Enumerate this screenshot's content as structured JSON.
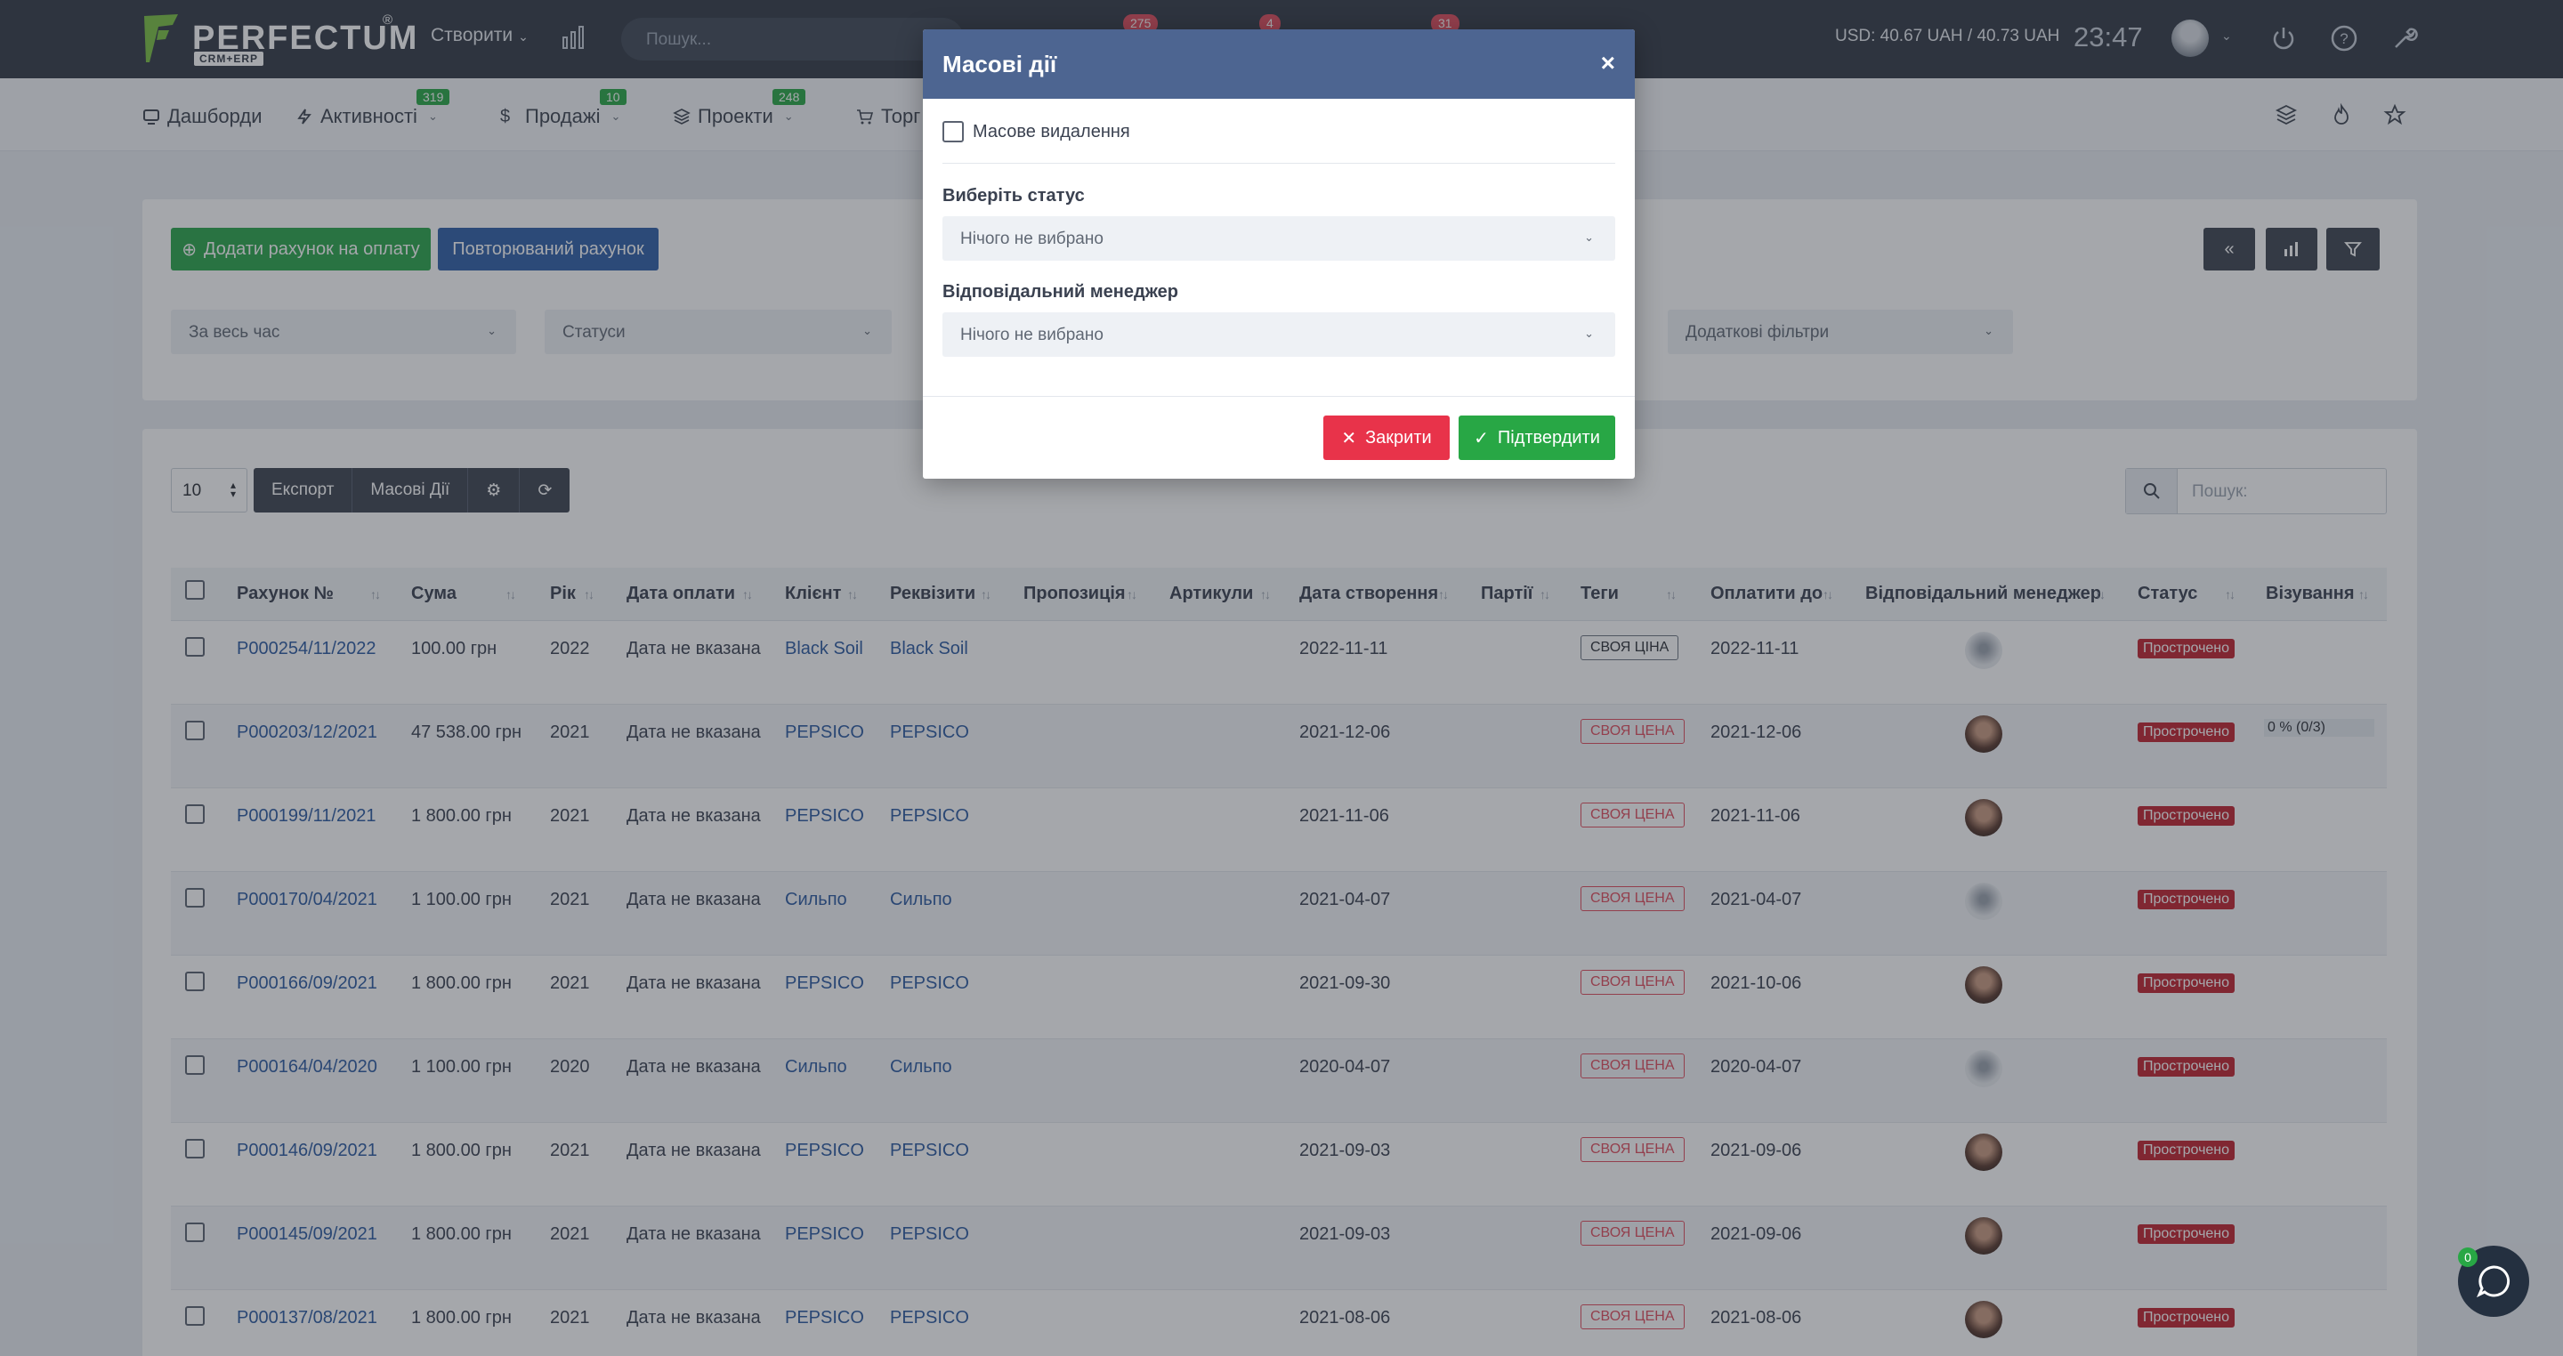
{
  "topbar": {
    "logo_text": "PERFECTUM",
    "logo_reg": "®",
    "logo_sub": "CRM+ERP",
    "create_label": "Створити",
    "search_placeholder": "Пошук...",
    "badges": [
      "275",
      "4",
      "31"
    ],
    "usd_rate": "USD: 40.67 UAH / 40.73 UAH",
    "clock": "23:47",
    "icons": [
      "power-icon",
      "help-icon",
      "wrench-icon"
    ]
  },
  "nav": {
    "items": [
      {
        "label": "Дашборди",
        "icon": "dashboard-icon",
        "badge": ""
      },
      {
        "label": "Активності",
        "icon": "activity-icon",
        "badge": "319"
      },
      {
        "label": "Продажі",
        "icon": "dollar-icon",
        "badge": "10"
      },
      {
        "label": "Проекти",
        "icon": "layers-icon",
        "badge": "248"
      },
      {
        "label": "Торг",
        "icon": "cart-icon",
        "badge": ""
      }
    ],
    "right_icons": [
      "layers-icon",
      "fire-icon",
      "star-icon"
    ]
  },
  "filters": {
    "add_invoice": "Додати рахунок на оплату",
    "recurring_invoice": "Повторюваний рахунок",
    "period": "За весь час",
    "statuses": "Статуси",
    "extra_filters": "Додаткові фільтри"
  },
  "toolbar": {
    "page_length": "10",
    "export": "Експорт",
    "mass_actions": "Масові Дії",
    "search_placeholder": "Пошук:"
  },
  "table": {
    "columns": [
      "Рахунок №",
      "Сума",
      "Рік",
      "Дата оплати",
      "Клієнт",
      "Реквізити",
      "Пропозиція",
      "Артикули",
      "Дата створення",
      "Партії",
      "Теги",
      "Оплатити до",
      "Відповідальний менеджер",
      "Статус",
      "Візування"
    ],
    "rows": [
      {
        "num": "P000254/11/2022",
        "sum": "100.00 грн",
        "year": "2022",
        "paid": "Дата не вказана",
        "client": "Black Soil",
        "req": "Black Soil",
        "created": "2022-11-11",
        "tag": "СВОЯ ЦІНА",
        "tag_style": "gray",
        "due": "2022-11-11",
        "manager": "m",
        "status": "Прострочено",
        "vis": ""
      },
      {
        "num": "P000203/12/2021",
        "sum": "47 538.00 грн",
        "year": "2021",
        "paid": "Дата не вказана",
        "client": "PEPSICO",
        "req": "PEPSICO",
        "created": "2021-12-06",
        "tag": "СВОЯ ЦЕНА",
        "tag_style": "red",
        "due": "2021-12-06",
        "manager": "f",
        "status": "Прострочено",
        "vis": "0 % (0/3)"
      },
      {
        "num": "P000199/11/2021",
        "sum": "1 800.00 грн",
        "year": "2021",
        "paid": "Дата не вказана",
        "client": "PEPSICO",
        "req": "PEPSICO",
        "created": "2021-11-06",
        "tag": "СВОЯ ЦЕНА",
        "tag_style": "red",
        "due": "2021-11-06",
        "manager": "f",
        "status": "Прострочено",
        "vis": ""
      },
      {
        "num": "P000170/04/2021",
        "sum": "1 100.00 грн",
        "year": "2021",
        "paid": "Дата не вказана",
        "client": "Сильпо",
        "req": "Сильпо",
        "created": "2021-04-07",
        "tag": "СВОЯ ЦЕНА",
        "tag_style": "red",
        "due": "2021-04-07",
        "manager": "m",
        "status": "Прострочено",
        "vis": ""
      },
      {
        "num": "P000166/09/2021",
        "sum": "1 800.00 грн",
        "year": "2021",
        "paid": "Дата не вказана",
        "client": "PEPSICO",
        "req": "PEPSICO",
        "created": "2021-09-30",
        "tag": "СВОЯ ЦЕНА",
        "tag_style": "red",
        "due": "2021-10-06",
        "manager": "f",
        "status": "Прострочено",
        "vis": ""
      },
      {
        "num": "P000164/04/2020",
        "sum": "1 100.00 грн",
        "year": "2020",
        "paid": "Дата не вказана",
        "client": "Сильпо",
        "req": "Сильпо",
        "created": "2020-04-07",
        "tag": "СВОЯ ЦЕНА",
        "tag_style": "red",
        "due": "2020-04-07",
        "manager": "m",
        "status": "Прострочено",
        "vis": ""
      },
      {
        "num": "P000146/09/2021",
        "sum": "1 800.00 грн",
        "year": "2021",
        "paid": "Дата не вказана",
        "client": "PEPSICO",
        "req": "PEPSICO",
        "created": "2021-09-03",
        "tag": "СВОЯ ЦЕНА",
        "tag_style": "red",
        "due": "2021-09-06",
        "manager": "f",
        "status": "Прострочено",
        "vis": ""
      },
      {
        "num": "P000145/09/2021",
        "sum": "1 800.00 грн",
        "year": "2021",
        "paid": "Дата не вказана",
        "client": "PEPSICO",
        "req": "PEPSICO",
        "created": "2021-09-03",
        "tag": "СВОЯ ЦЕНА",
        "tag_style": "red",
        "due": "2021-09-06",
        "manager": "f",
        "status": "Прострочено",
        "vis": ""
      },
      {
        "num": "P000137/08/2021",
        "sum": "1 800.00 грн",
        "year": "2021",
        "paid": "Дата не вказана",
        "client": "PEPSICO",
        "req": "PEPSICO",
        "created": "2021-08-06",
        "tag": "СВОЯ ЦЕНА",
        "tag_style": "red",
        "due": "2021-08-06",
        "manager": "f",
        "status": "Прострочено",
        "vis": ""
      }
    ]
  },
  "modal": {
    "title": "Масові дії",
    "close": "×",
    "mass_delete": "Масове видалення",
    "status_label": "Виберіть статус",
    "status_value": "Нічого не вибрано",
    "manager_label": "Відповідальний менеджер",
    "manager_value": "Нічого не вибрано",
    "cancel": "Закрити",
    "confirm": "Підтвердити"
  },
  "chat": {
    "badge": "0"
  },
  "colors": {
    "topbar": "#323a46",
    "modal_header": "#4d6591",
    "green": "#28a745",
    "red": "#e8334a",
    "blue": "#2f5fa8"
  }
}
